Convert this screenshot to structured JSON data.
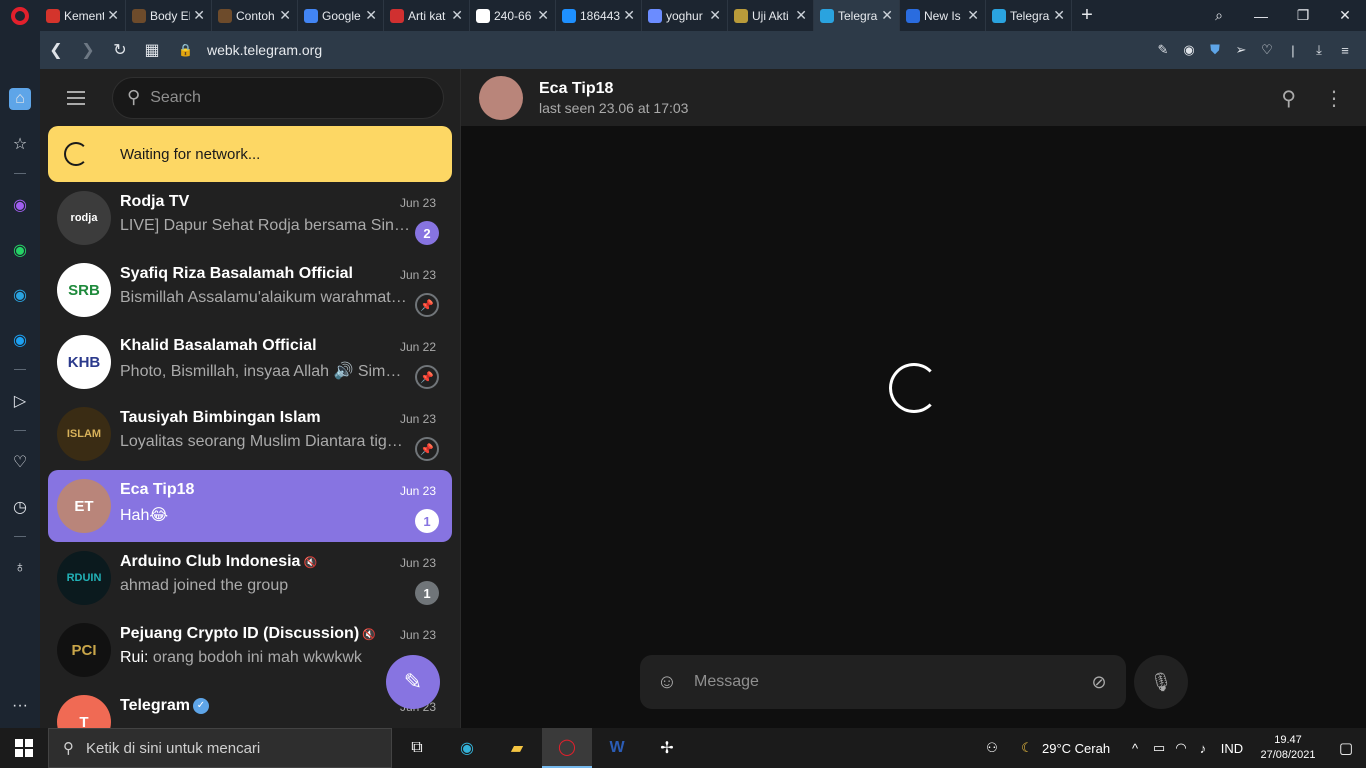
{
  "browser": {
    "tabs": [
      {
        "title": "Kementr",
        "color": "#d4342c"
      },
      {
        "title": "Body El",
        "color": "#6d4b2b"
      },
      {
        "title": "Contoh",
        "color": "#6d4b2b"
      },
      {
        "title": "Google",
        "color": "#4285f4"
      },
      {
        "title": "Arti kat",
        "color": "#d03030"
      },
      {
        "title": "240-66",
        "color": "#ffffff"
      },
      {
        "title": "186443",
        "color": "#1e90ff"
      },
      {
        "title": "yoghur",
        "color": "#6b8cff"
      },
      {
        "title": "Uji Akti",
        "color": "#b99b3a"
      },
      {
        "title": "Telegra",
        "color": "#2aa3df",
        "active": true
      },
      {
        "title": "New Is",
        "color": "#2a6cdf"
      },
      {
        "title": "Telegra",
        "color": "#2aa3df"
      }
    ],
    "url": "webk.telegram.org"
  },
  "telegram": {
    "search_placeholder": "Search",
    "network_warning": "Waiting for network...",
    "chats": [
      {
        "name": "Rodja TV",
        "date": "Jun 23",
        "message": "LIVE] Dapur Sehat Rodja bersama Sinse Muhammad Yusuf",
        "badge": "2",
        "avatar_text": "rodja",
        "avatar_bg": "#3c3c3c",
        "avatar_fg": "#ffffff"
      },
      {
        "name": "Syafiq Riza Basalamah Official",
        "date": "Jun 23",
        "message": "Bismillah Assalamu'alaikum warahmatullah",
        "pinned": true,
        "avatar_text": "SRB",
        "avatar_bg": "#ffffff",
        "avatar_fg": "#1f8a3c"
      },
      {
        "name": "Khalid Basalamah Official",
        "date": "Jun 22",
        "message": "Photo, Bismillah, insyaa Allah 🔊 Simak kajian",
        "pinned": true,
        "avatar_text": "KHB",
        "avatar_bg": "#ffffff",
        "avatar_fg": "#2b3a8c"
      },
      {
        "name": "Tausiyah Bimbingan Islam",
        "date": "Jun 23",
        "message": "Loyalitas seorang Muslim Diantara tiga perkara",
        "pinned": true,
        "avatar_text": "ISLAM",
        "avatar_bg": "#3a2c14",
        "avatar_fg": "#d8b25a"
      },
      {
        "name": "Eca Tip18",
        "date": "Jun 23",
        "message": "Hah😂",
        "badge": "1",
        "active": true,
        "avatar_text": "ET",
        "avatar_bg": "#b9857a",
        "avatar_fg": "#ffffff"
      },
      {
        "name": "Arduino Club Indonesia",
        "date": "Jun 23",
        "message": "ahmad joined the group",
        "badge": "1",
        "muted": true,
        "avatar_text": "RDUIN",
        "avatar_bg": "#0b1a1e",
        "avatar_fg": "#22b3b8"
      },
      {
        "name": "Pejuang Crypto ID (Discussion)",
        "date": "Jun 23",
        "sender": "Rui:",
        "message": "orang bodoh ini mah wkwkwk",
        "muted": true,
        "avatar_text": "PCI",
        "avatar_bg": "#111111",
        "avatar_fg": "#c9a64a"
      },
      {
        "name": "Telegram",
        "date": "Jun 23",
        "message": "",
        "verified": true,
        "avatar_text": "T",
        "avatar_bg": "#f06a54",
        "avatar_fg": "#ffffff"
      }
    ],
    "conversation": {
      "name": "Eca Tip18",
      "status": "last seen 23.06 at 17:03",
      "composer_placeholder": "Message"
    }
  },
  "taskbar": {
    "search_placeholder": "Ketik di sini untuk mencari",
    "weather": "29°C  Cerah",
    "lang": "IND",
    "time": "19.47",
    "date": "27/08/2021"
  }
}
